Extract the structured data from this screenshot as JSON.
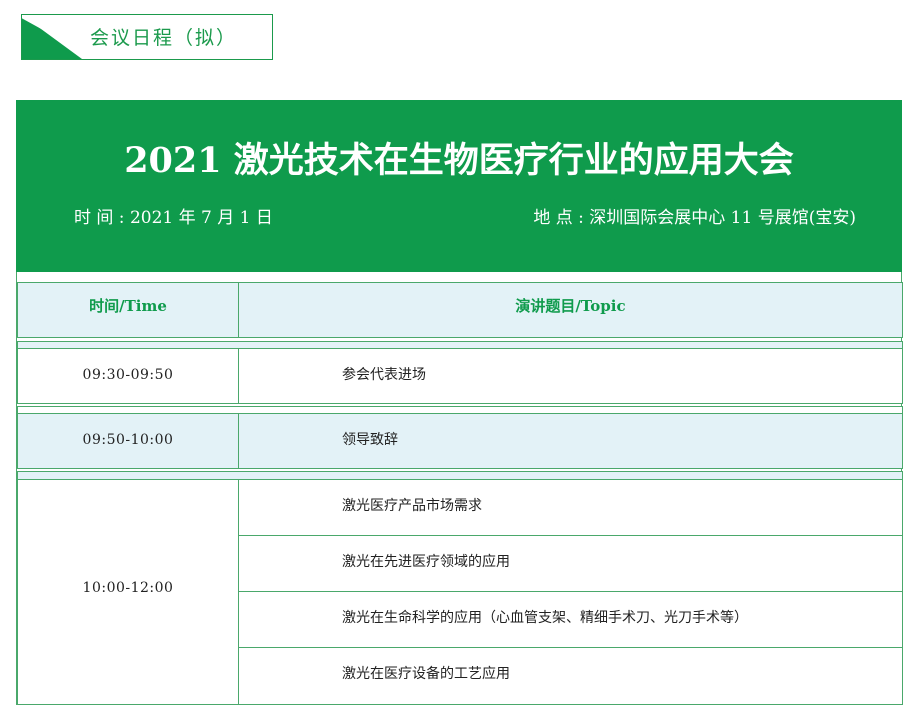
{
  "section_tag": {
    "label": "会议日程（拟）"
  },
  "banner": {
    "title": "2021 激光技术在生物医疗行业的应用大会",
    "time": "时 间 : 2021 年 7 月 1 日",
    "place": "地 点 : 深圳国际会展中心 11 号展馆(宝安)"
  },
  "colors": {
    "brand_green": "#0f9b4c",
    "header_bg": "#e3f2f7",
    "border": "#4aa86b"
  },
  "table": {
    "headers": {
      "time": "时间/Time",
      "topic": "演讲题目/Topic"
    },
    "rows": [
      {
        "time": "09:30-09:50",
        "topics": [
          "参会代表进场"
        ]
      },
      {
        "time": "09:50-10:00",
        "topics": [
          "领导致辞"
        ]
      },
      {
        "time": "10:00-12:00",
        "topics": [
          "激光医疗产品市场需求",
          "激光在先进医疗领域的应用",
          "激光在生命科学的应用（心血管支架、精细手术刀、光刀手术等）",
          "激光在医疗设备的工艺应用"
        ]
      }
    ]
  }
}
